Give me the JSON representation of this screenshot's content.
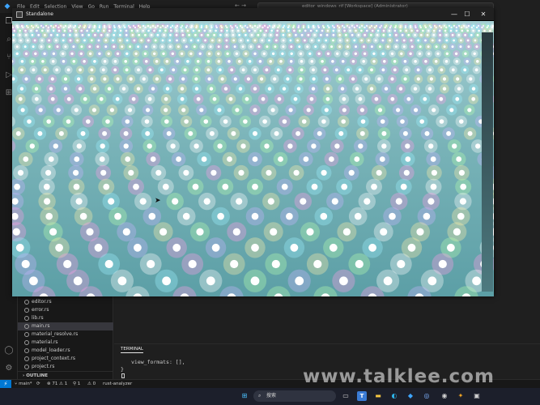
{
  "menu": {
    "items": [
      "File",
      "Edit",
      "Selection",
      "View",
      "Go",
      "Run",
      "Terminal",
      "Help"
    ],
    "nav": "←  →",
    "command_center": "editor_windows_rif [Workspace] (Administrator)"
  },
  "explorer": {
    "files": [
      "editor.rs",
      "error.rs",
      "lib.rs",
      "main.rs",
      "material_resolve.rs",
      "material.rs",
      "model_loader.rs",
      "project_context.rs",
      "project.rs"
    ],
    "active_file": "main.rs",
    "outline_label": "OUTLINE"
  },
  "terminal": {
    "tab_label": "TERMINAL",
    "lines": [
      "view_formats: [],",
      "}"
    ]
  },
  "statusbar": {
    "branch": "main*",
    "sync_icon": "sync-icon",
    "problems": "⊗ 71 ⚠ 1",
    "ports": "⚲ 1",
    "warnings": "⚠ 0",
    "analyzer": "rust-analyzer"
  },
  "taskbar": {
    "search_placeholder": "搜索"
  },
  "standalone": {
    "title": "Standalone",
    "buttons": [
      "—",
      "☐",
      "✕"
    ],
    "floor_color": "#6fb2b6",
    "light_colors": [
      "#ffffff",
      "#ff9ee8",
      "#9ef0ff",
      "#b7ffb0",
      "#fff2a8",
      "#c8b4ff"
    ]
  },
  "watermark": "www.talklee.com"
}
